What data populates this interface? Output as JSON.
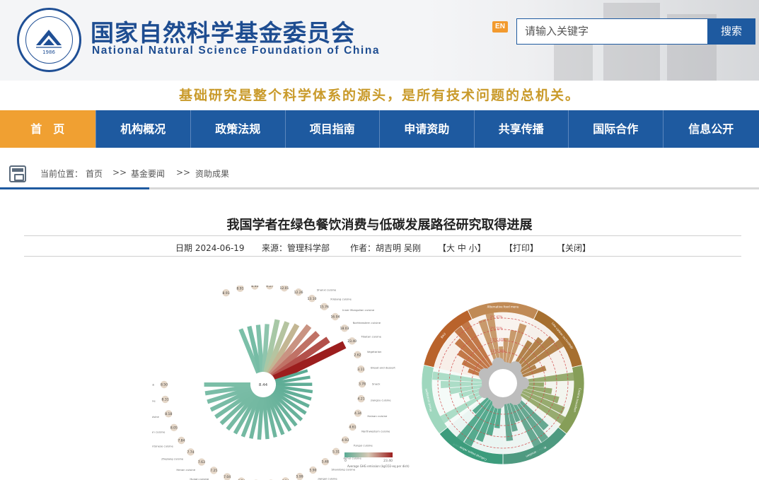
{
  "header": {
    "title_cn": "国家自然科学基金委员会",
    "title_en": "National Natural Science Foundation of China",
    "logo_year": "1986",
    "logo_ring_text": "国家自然科学基金委员会 NATIONAL NATURAL SCIENCE FOUNDATION OF CHINA",
    "lang_toggle": "EN",
    "search_placeholder": "请输入关键字",
    "search_button": "搜索"
  },
  "slogan": "基础研究是整个科学体系的源头，是所有技术问题的总机关。",
  "nav": {
    "items": [
      {
        "label": "首　页",
        "active": true
      },
      {
        "label": "机构概况",
        "active": false
      },
      {
        "label": "政策法规",
        "active": false
      },
      {
        "label": "项目指南",
        "active": false
      },
      {
        "label": "申请资助",
        "active": false
      },
      {
        "label": "共享传播",
        "active": false
      },
      {
        "label": "国际合作",
        "active": false
      },
      {
        "label": "信息公开",
        "active": false
      }
    ]
  },
  "breadcrumb": {
    "prefix": "当前位置：",
    "items": [
      "首页",
      "基金要闻",
      "资助成果"
    ],
    "separator": ">>"
  },
  "article": {
    "title": "我国学者在绿色餐饮消费与低碳发展路径研究取得进展",
    "date": "日期 2024-06-19",
    "source": "来源：管理科学部",
    "author": "作者：胡吉明 吴刚",
    "font_size_controls": "【大 中 小】",
    "print": "【打印】",
    "close": "【关闭】"
  },
  "figure": {
    "left_center_value": "8.44",
    "left_legend": "Average GHG emission (kgCO2-eq per dish)",
    "left_legend_min": "0",
    "left_legend_max": "23.40",
    "radial_bars": [
      {
        "label": "Hot pot",
        "value": 8.91,
        "c": "#7bbfa8"
      },
      {
        "label": "Guangxi cuisine",
        "value": 8.91,
        "c": "#76bca5"
      },
      {
        "label": "Hebei Seafood and river food",
        "value": 8.94,
        "c": "#80c1aa"
      },
      {
        "label": "Western food",
        "value": 9.27,
        "c": "#8ec5ad"
      },
      {
        "label": "Barbecue",
        "value": 12.01,
        "c": "#a8c8a6"
      },
      {
        "label": "Sichuan cuisine",
        "value": 12.26,
        "c": "#b5c4a0"
      },
      {
        "label": "Shanxi cuisine",
        "value": 13.1,
        "c": "#c3b693"
      },
      {
        "label": "Xinjiang cuisine",
        "value": 15.76,
        "c": "#c99382"
      },
      {
        "label": "Inner Mongolian cuisine",
        "value": 16.04,
        "c": "#c07266"
      },
      {
        "label": "Northeastern cuisine",
        "value": 18.03,
        "c": "#b3504b"
      },
      {
        "label": "Tibetan cuisine",
        "value": 23.4,
        "c": "#9c1e1e"
      },
      {
        "label": "Vegetarian",
        "value": 2.62,
        "c": "#59ab94"
      },
      {
        "label": "Bread and dessert",
        "value": 3.11,
        "c": "#5fad96"
      },
      {
        "label": "Snack",
        "value": 3.78,
        "c": "#5fad96"
      },
      {
        "label": "Jiangsu cuisine",
        "value": 4.21,
        "c": "#62af98"
      },
      {
        "label": "Hainan cuisine",
        "value": 4.34,
        "c": "#62af98"
      },
      {
        "label": "Northwestern cuisine",
        "value": 4.61,
        "c": "#64b099"
      },
      {
        "label": "Yungui cuisine",
        "value": 4.93,
        "c": "#66b19a"
      },
      {
        "label": "Anhui cuisine",
        "value": 5.31,
        "c": "#68b29b"
      },
      {
        "label": "Shandong cuisine",
        "value": 5.48,
        "c": "#6ab39c"
      },
      {
        "label": "Jiangxi cuisine",
        "value": 5.9,
        "c": "#6cb49d"
      },
      {
        "label": "Korean cuisine",
        "value": 5.99,
        "c": "#6eb59e"
      },
      {
        "label": "Shanghai cuisine",
        "value": 6.14,
        "c": "#6fb69f"
      },
      {
        "label": "Hubei cuisine",
        "value": 6.46,
        "c": "#71b7a0"
      },
      {
        "label": "Japanese cuisine",
        "value": 6.69,
        "c": "#72b8a1"
      },
      {
        "label": "Beijing cuisine",
        "value": 6.74,
        "c": "#72b8a1"
      },
      {
        "label": "Fujian cuisine",
        "value": 7.04,
        "c": "#74b9a2"
      },
      {
        "label": "Hunan cuisine",
        "value": 7.25,
        "c": "#74b9a2"
      },
      {
        "label": "Henan cuisine",
        "value": 7.63,
        "c": "#76baa3"
      },
      {
        "label": "Zhejiang cuisine",
        "value": 7.74,
        "c": "#76baa3"
      },
      {
        "label": "Cantonese cuisine",
        "value": 7.84,
        "c": "#77bba4"
      },
      {
        "label": "Southeast Asian cuisine",
        "value": 8.05,
        "c": "#78bba5"
      },
      {
        "label": "Tianjin cuisine",
        "value": 8.18,
        "c": "#79bca6"
      },
      {
        "label": "Taiwanese cuisine",
        "value": 8.31,
        "c": "#7abda7"
      },
      {
        "label": "Kebab",
        "value": 8.5,
        "c": "#7bbea7"
      }
    ],
    "right_sectors": [
      {
        "label": "BAU",
        "color": "#b9632b"
      },
      {
        "label": "Alternative food menu",
        "color": "#c08a55"
      },
      {
        "label": "Low-carbon technology",
        "color": "#a66f2f"
      },
      {
        "label": "Cuisine transition",
        "color": "#869e58"
      },
      {
        "label": "Menu transition",
        "color": "#4e9a80"
      },
      {
        "label": "Cultural-intent refinement",
        "color": "#3c9c7c"
      },
      {
        "label": "Mixed strategies",
        "color": "#9fd7be"
      }
    ],
    "right_ring_labels": [
      "2°C 67%",
      "2°C 50%",
      "1.5°C 67%",
      "1.5°C 50%"
    ],
    "right_years": [
      "2020",
      "2030",
      "2040",
      "2050",
      "2060",
      "2025"
    ]
  }
}
